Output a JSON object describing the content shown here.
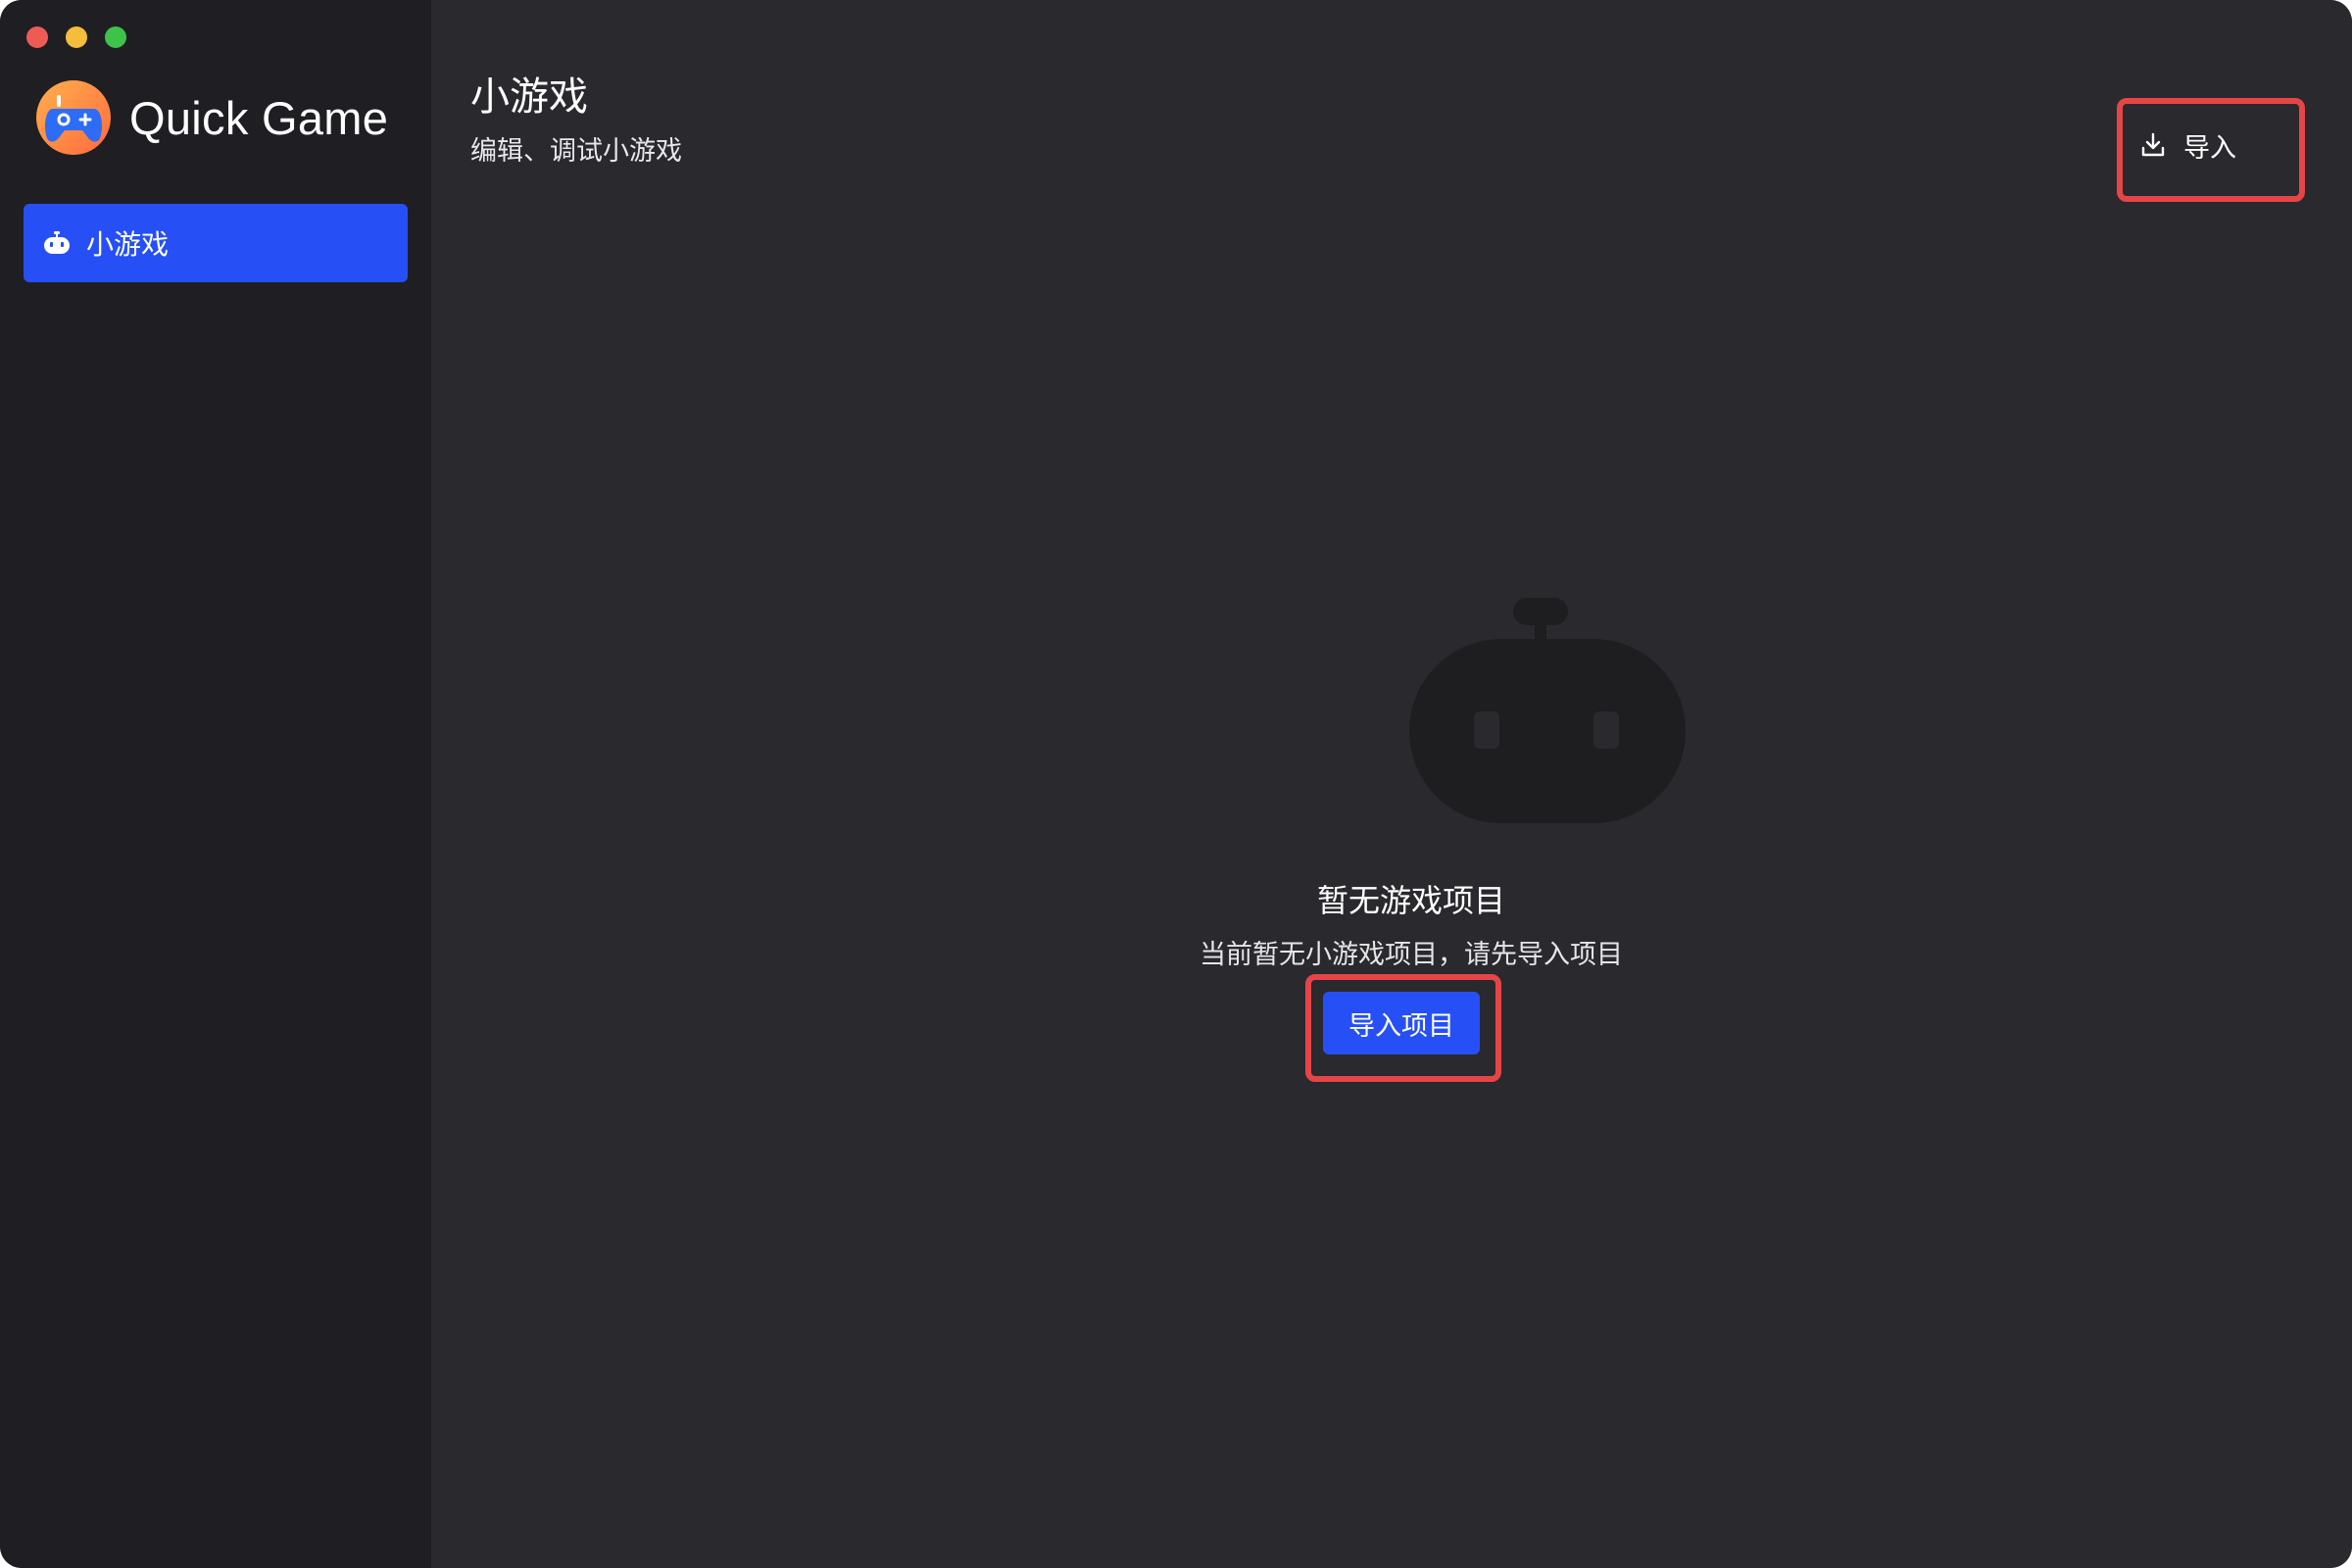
{
  "app": {
    "title": "Quick Game",
    "logo_icon": "gamepad-icon",
    "window_controls": [
      "close",
      "minimize",
      "maximize"
    ]
  },
  "sidebar": {
    "items": [
      {
        "label": "小游戏",
        "icon": "robot-icon",
        "active": true
      }
    ]
  },
  "header": {
    "title": "小游戏",
    "subtitle": "编辑、调试小游戏",
    "import_label": "导入",
    "import_icon": "download-icon"
  },
  "empty_state": {
    "icon": "robot-icon",
    "title": "暂无游戏项目",
    "description": "当前暂无小游戏项目，请先导入项目",
    "button_label": "导入项目"
  },
  "colors": {
    "accent": "#2650f5",
    "highlight": "#e64547",
    "sidebar_bg": "#1f1e23",
    "main_bg": "#2a292e"
  }
}
